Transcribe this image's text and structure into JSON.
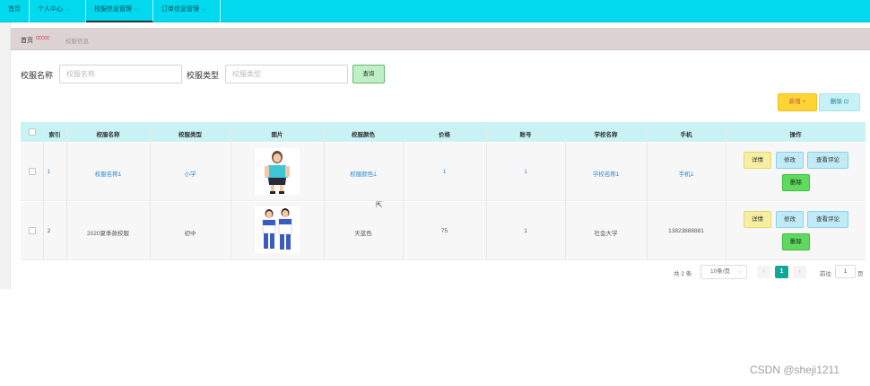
{
  "nav": {
    "items": [
      {
        "label": "首页",
        "dropdown": false
      },
      {
        "label": "个人中心",
        "dropdown": true
      },
      {
        "label": "校服信息管理",
        "dropdown": true,
        "active": true
      },
      {
        "label": "订单信息管理",
        "dropdown": true
      }
    ]
  },
  "breadcrumb": {
    "home": "首页",
    "separator": "ccccc",
    "current": "校服信息"
  },
  "search": {
    "name_label": "校服名称",
    "name_placeholder": "校服名称",
    "type_label": "校服类型",
    "type_placeholder": "校服类型",
    "query_label": "查询"
  },
  "actions": {
    "add_label": "新增 +",
    "delete_label": "删除 ⊡"
  },
  "table": {
    "headers": [
      "索引",
      "校服名称",
      "校服类型",
      "图片",
      "校服颜色",
      "价格",
      "账号",
      "学校名称",
      "手机",
      "操作"
    ],
    "rows": [
      {
        "index": "1",
        "name": "校服名称1",
        "type": "小学",
        "image": "student-girl-uniform-photo",
        "color": "校服颜色1",
        "price": "1",
        "account": "1",
        "school": "学校名称1",
        "phone": "手机1"
      },
      {
        "index": "2",
        "name": "2020夏季款校服",
        "type": "初中",
        "image": "student-pair-uniform-photo",
        "color": "天蓝色",
        "price": "75",
        "account": "1",
        "school": "社会大学",
        "phone": "13823888881"
      }
    ],
    "op_labels": {
      "detail": "详情",
      "edit": "修改",
      "review": "查看评论",
      "delete": "删除"
    }
  },
  "pagination": {
    "total": "共 2 条",
    "page_size": "10条/页",
    "prev": "‹",
    "current": "1",
    "next": "›",
    "goto": "前往",
    "goto_value": "1",
    "page_suffix": "页"
  },
  "watermark": "CSDN @sheji1211",
  "colors": {
    "nav_bg": "#00d9ee",
    "breadcrumb_bg": "#ddd3d3",
    "table_header_bg": "#c9f2f5",
    "add_btn": "#ffd535",
    "delete_op": "#5fda5f",
    "pager_active": "#13a79a"
  }
}
